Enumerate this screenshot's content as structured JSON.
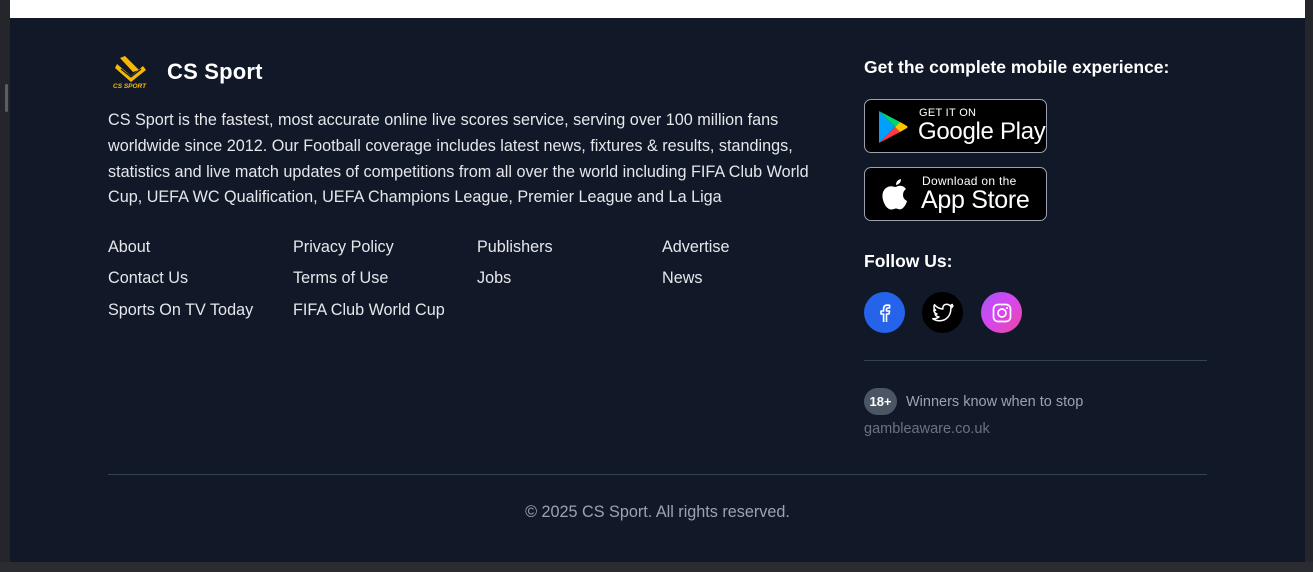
{
  "brand": {
    "name": "CS Sport",
    "logo_text": "CS SPORT",
    "description": "CS Sport is the fastest, most accurate online live scores service, serving over 100 million fans worldwide since 2012. Our Football coverage includes latest news, fixtures & results, standings, statistics and live match updates of competitions from all over the world including FIFA Club World Cup, UEFA WC Qualification, UEFA Champions League, Premier League and La Liga"
  },
  "links": {
    "about": "About",
    "contact": "Contact Us",
    "sports_tv": "Sports On TV Today",
    "privacy": "Privacy Policy",
    "terms": "Terms of Use",
    "fifa": "FIFA Club World Cup",
    "publishers": "Publishers",
    "jobs": "Jobs",
    "advertise": "Advertise",
    "news": "News"
  },
  "mobile": {
    "title": "Get the complete mobile experience:",
    "google_play": {
      "small": "GET IT ON",
      "big": "Google Play"
    },
    "app_store": {
      "small": "Download on the",
      "big": "App Store"
    }
  },
  "follow": {
    "title": "Follow Us:",
    "icons": [
      "facebook-icon",
      "twitter-icon",
      "instagram-icon"
    ]
  },
  "responsible": {
    "age": "18+",
    "text": "Winners know when to stop",
    "link": "gambleaware.co.uk"
  },
  "copyright": "© 2025 CS Sport. All rights reserved.",
  "colors": {
    "background": "#111827",
    "accent": "#f5b70a",
    "facebook": "#2563eb",
    "twitter": "#000000",
    "instagram": "#d946ef"
  }
}
